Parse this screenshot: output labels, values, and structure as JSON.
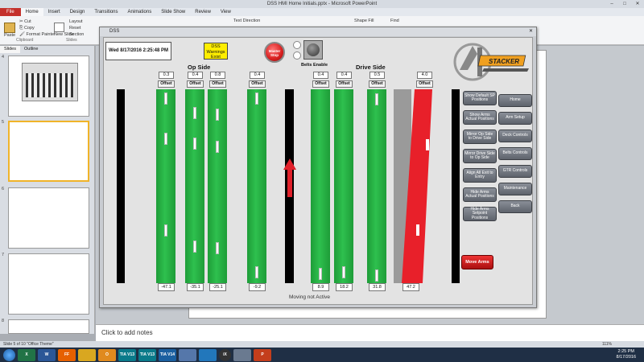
{
  "powerpoint": {
    "title": "DSS HMI Home Initials.pptx - Microsoft PowerPoint",
    "tabs": [
      "File",
      "Home",
      "Insert",
      "Design",
      "Transitions",
      "Animations",
      "Slide Show",
      "Review",
      "View"
    ],
    "ribbon": {
      "cut": "Cut",
      "copy": "Copy",
      "format_painter": "Format Painter",
      "paste": "Paste",
      "clipboard": "Clipboard",
      "new_slide": "New Slide",
      "layout": "Layout",
      "reset": "Reset",
      "section": "Section",
      "slides": "Slides",
      "text_direction": "Text Direction",
      "shape_fill": "Shape Fill",
      "find": "Find"
    },
    "left_tabs": [
      "Slides",
      "Outline"
    ],
    "slide_numbers": [
      "4",
      "5",
      "6",
      "7",
      "8"
    ],
    "notes_placeholder": "Click to add notes",
    "status_left": "Slide 5 of 10   \"Office Theme\"",
    "zoom": "111%"
  },
  "taskbar": {
    "icons": [
      "X",
      "W",
      "FF",
      "",
      "O",
      "TIA V13",
      "TIA V13",
      "TIA V14",
      "",
      "",
      "iX",
      "",
      "P"
    ],
    "time": "2:25 PM",
    "date": "8/17/2016"
  },
  "dss": {
    "window_title": "DSS",
    "datetime": "Wed 8/17/2016 2:25:48 PM",
    "warning": "DSS Warnings Exist",
    "estop": "Master Stop",
    "belts_enable": "Belts Enable",
    "op_side_label": "Op Side",
    "drive_side_label": "Drive Side",
    "offset_label": "Offset",
    "status": "Moving not Active",
    "logo_text": "STACKER",
    "op_arms": [
      {
        "offset": "0.3",
        "position": "-47.1"
      },
      {
        "offset": "0.4",
        "position": "-35.1"
      },
      {
        "offset": "0.8",
        "position": "-25.1"
      },
      {
        "offset": "0.4",
        "position": "-9.2"
      }
    ],
    "drive_arms": [
      {
        "offset": "0.4",
        "position": "8.9"
      },
      {
        "offset": "0.4",
        "position": "18.2"
      },
      {
        "offset": "0.5",
        "position": "31.8"
      },
      {
        "offset": "4.0",
        "position": "47.2"
      }
    ],
    "buttons_left": [
      "Show Default SP Positions",
      "Show Arms Actual Positions",
      "Mirror Op Side to Drive Side",
      "Mirror Drive Side to Op Side",
      "Align All Exit to Entry",
      "Hide Arms Actual Positions",
      "Hide Arms Setpoint Positions"
    ],
    "buttons_right": [
      "Home",
      "Arm Setup",
      "Deck Controls",
      "Belts Controls",
      "GTR Controls",
      "Maintenance",
      "Back"
    ],
    "move_arms": "Move Arms",
    "colors": {
      "bar": "#2ec04e",
      "alarm": "#e8202a",
      "warning": "#ffee00",
      "arrow": "#e0202a"
    }
  }
}
